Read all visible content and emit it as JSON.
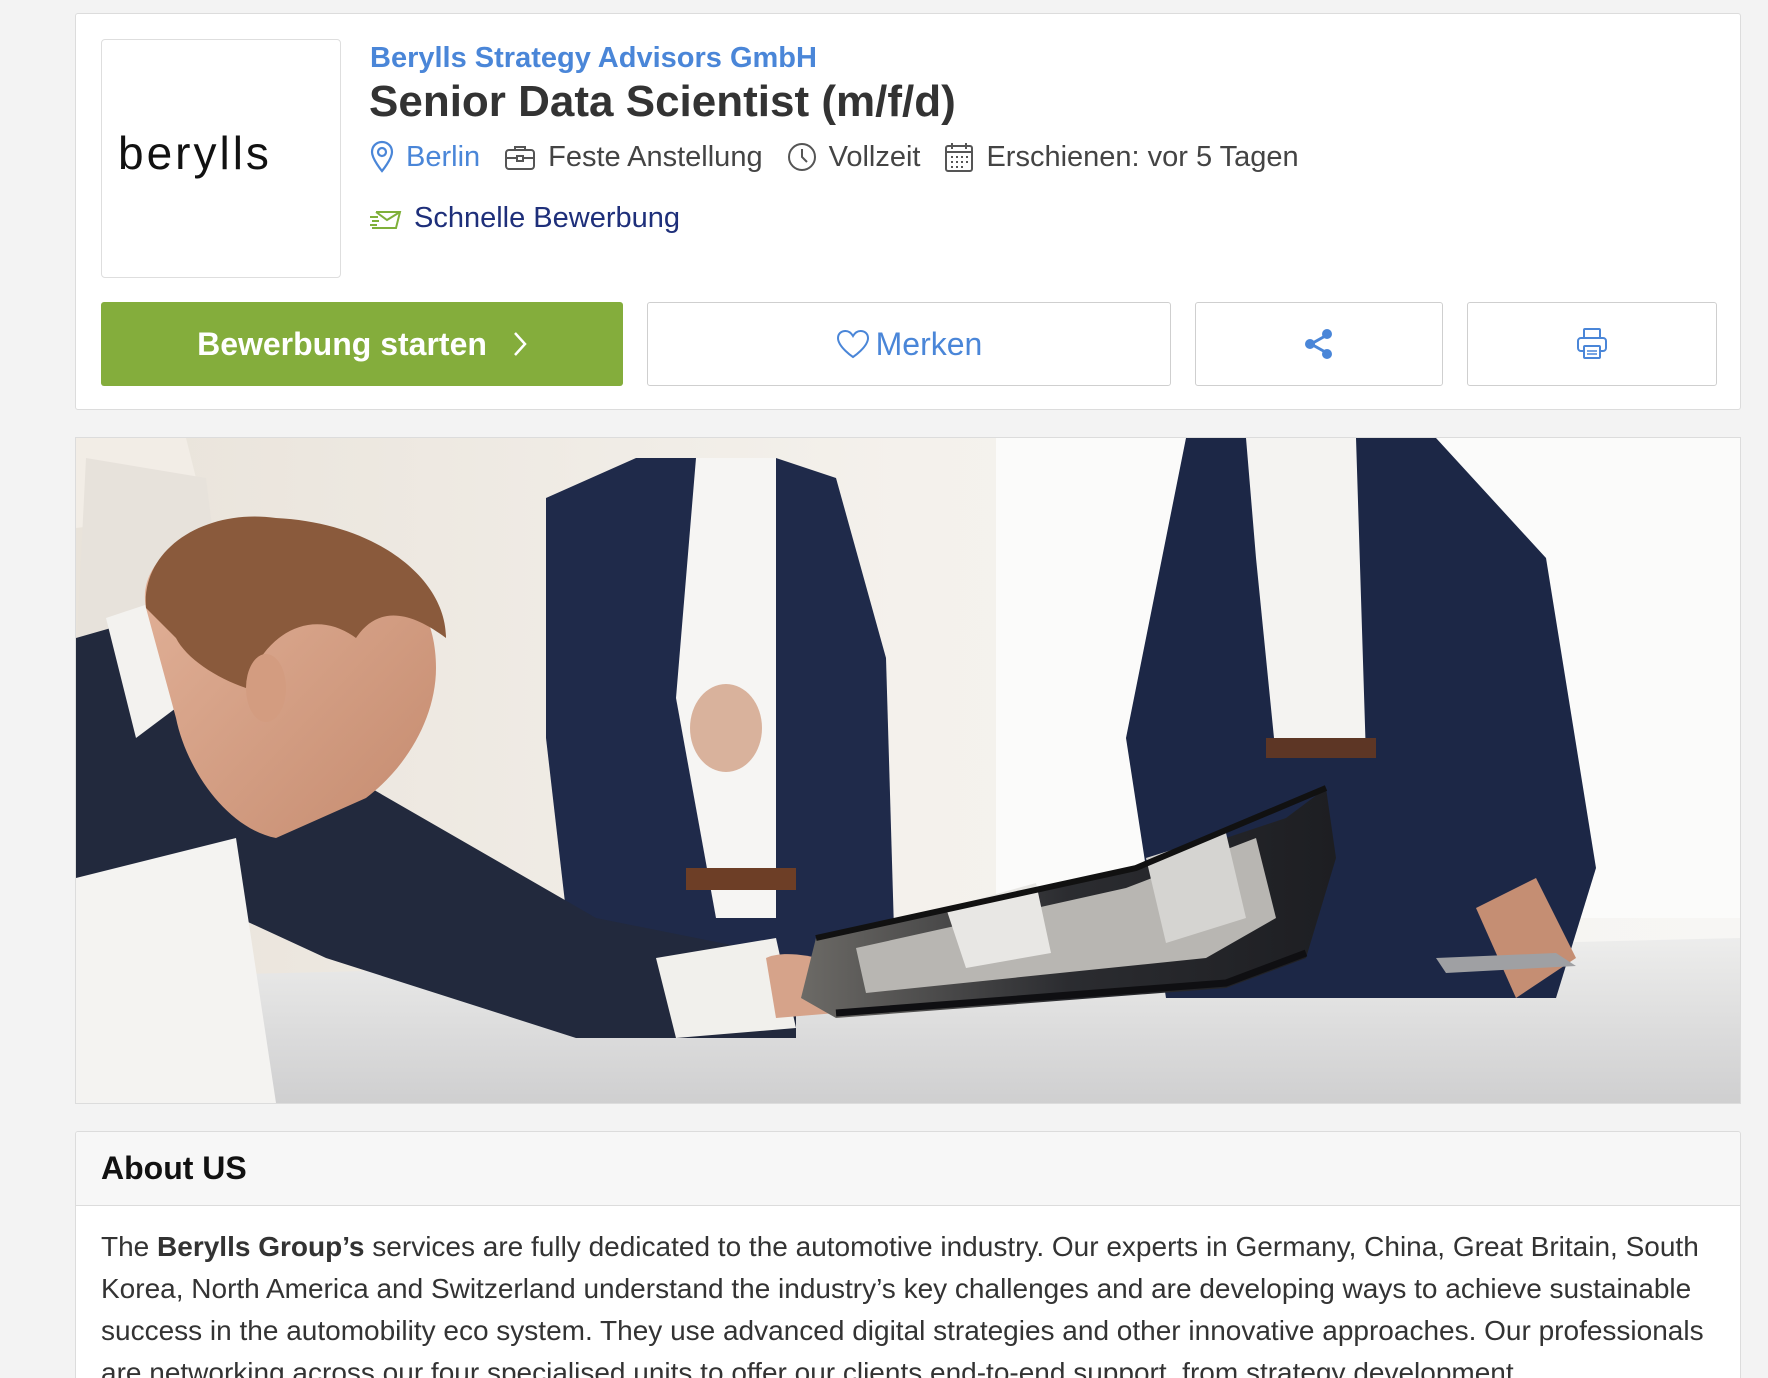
{
  "company": {
    "name": "Berylls Strategy Advisors GmbH",
    "logo_text": "berylls"
  },
  "job": {
    "title": "Senior Data Scientist (m/f/d)",
    "location": "Berlin",
    "employment_type": "Feste Anstellung",
    "work_time": "Vollzeit",
    "published": "Erschienen: vor 5 Tagen",
    "quick_apply": "Schnelle Bewerbung"
  },
  "actions": {
    "apply_label": "Bewerbung starten",
    "save_label": "Merken"
  },
  "icons": {
    "location": "map-pin-icon",
    "employment": "briefcase-icon",
    "time": "clock-icon",
    "date": "calendar-icon",
    "quick_apply": "fast-mail-icon",
    "save": "heart-icon",
    "share": "share-icon",
    "print": "printer-icon",
    "apply_chevron": "chevron-right-icon"
  },
  "about": {
    "title": "About US",
    "text_prefix": "The ",
    "text_bold": "Berylls Group’s",
    "text_rest": " services are fully dedicated to the automotive industry. Our experts in Germany, China, Great Britain, South Korea, North America and Switzerland understand the industry’s key challenges and are developing ways to achieve sustainable success in the automobility eco system. They use advanced digital strategies and other innovative approaches. Our professionals are networking across our four specialised units to offer our clients end-to-end support, from strategy development"
  },
  "colors": {
    "accent_blue": "#4a86d8",
    "apply_green": "#84ad3c",
    "quick_apply_green": "#7fb03a",
    "title_dark": "#333333",
    "navy_text": "#1e2f7a"
  }
}
